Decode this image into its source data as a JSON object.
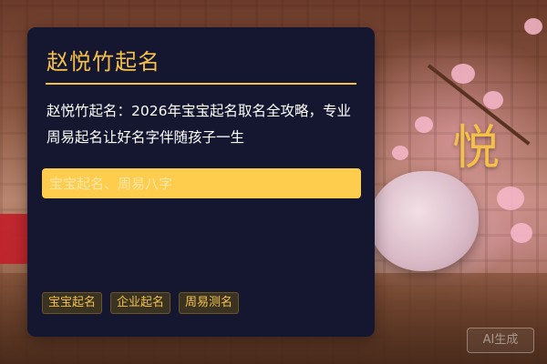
{
  "card": {
    "title": "赵悦竹起名",
    "description": "赵悦竹起名：2026年宝宝起名取名全攻略，专业周易起名让好名字伴随孩子一生"
  },
  "search": {
    "placeholder": "宝宝起名、周易八字",
    "value": ""
  },
  "tags": [
    {
      "label": "宝宝起名"
    },
    {
      "label": "企业起名"
    },
    {
      "label": "周易测名"
    }
  ],
  "decor": {
    "big_char": "悦",
    "watermark": "AI生成"
  },
  "colors": {
    "accent": "#f5c04a",
    "card_bg": "#151731",
    "search_bg": "#ffcd4d",
    "tag_bg": "#3a3322"
  }
}
